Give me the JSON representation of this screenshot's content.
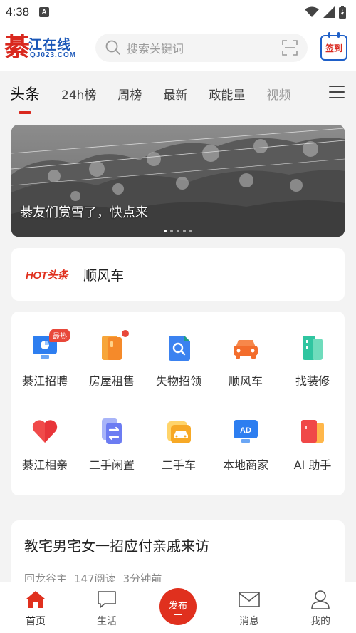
{
  "status_bar": {
    "time": "4:38",
    "notif_badge": "A"
  },
  "header": {
    "logo_big": "綦",
    "logo_text": "江在线",
    "logo_url": "QJ023.COM",
    "search_placeholder": "搜索关键词",
    "checkin_label": "签到"
  },
  "tabs": [
    {
      "label": "头条",
      "active": true
    },
    {
      "label": "24h榜"
    },
    {
      "label": "周榜"
    },
    {
      "label": "最新"
    },
    {
      "label": "政能量"
    },
    {
      "label": "视频"
    }
  ],
  "banner": {
    "caption": "綦友们赏雪了，快点来"
  },
  "hot": {
    "tag": "HOT头条",
    "text": "顺风车"
  },
  "services": [
    {
      "label": "綦江招聘",
      "icon": "monitor-icon",
      "badge": "最热"
    },
    {
      "label": "房屋租售",
      "icon": "door-icon"
    },
    {
      "label": "失物招领",
      "icon": "search-doc-icon"
    },
    {
      "label": "顺风车",
      "icon": "car-icon"
    },
    {
      "label": "找装修",
      "icon": "building-icon"
    },
    {
      "label": "綦江相亲",
      "icon": "heart-icon"
    },
    {
      "label": "二手闲置",
      "icon": "exchange-icon"
    },
    {
      "label": "二手车",
      "icon": "used-car-icon"
    },
    {
      "label": "本地商家",
      "icon": "ad-screen-icon",
      "ad_text": "AD"
    },
    {
      "label": "AI 助手",
      "icon": "ai-cards-icon"
    }
  ],
  "article": {
    "title": "教宅男宅女一招应付亲戚来访",
    "author": "回龙谷主",
    "reads": "147阅读",
    "time": "3分钟前"
  },
  "nav": {
    "home": "首页",
    "life": "生活",
    "publish": "发布",
    "messages": "消息",
    "mine": "我的"
  },
  "colors": {
    "brand_red": "#e0301e",
    "brand_blue": "#1b57b8"
  }
}
